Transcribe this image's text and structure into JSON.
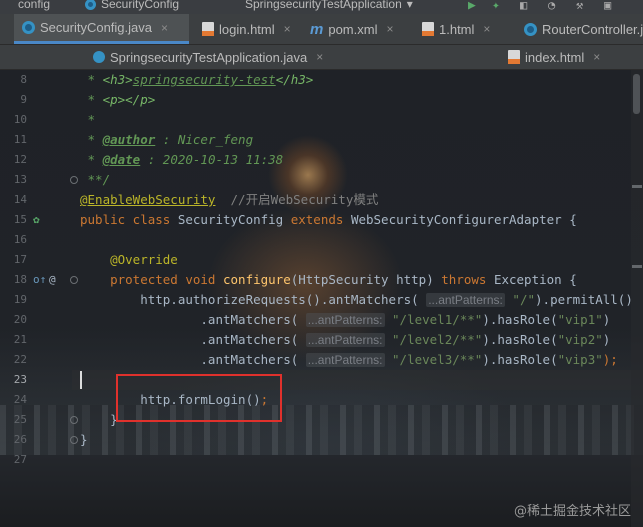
{
  "tabs_row1": {
    "items": [
      "config",
      "SecurityConfig",
      "SpringsecurityTestApplication"
    ]
  },
  "tabs_row2": [
    {
      "label": "SecurityConfig.java",
      "icon": "class-icon",
      "active": true
    },
    {
      "label": "login.html",
      "icon": "html-file-icon",
      "active": false
    },
    {
      "label": "pom.xml",
      "icon": "maven-icon",
      "active": false
    },
    {
      "label": "1.html",
      "icon": "html-file-icon",
      "active": false
    },
    {
      "label": "RouterController.jav",
      "icon": "class-icon",
      "active": false
    }
  ],
  "tabs_row3": [
    {
      "label": "SpringsecurityTestApplication.java",
      "icon": "spring-class-icon"
    },
    {
      "label": "index.html",
      "icon": "html-file-icon"
    }
  ],
  "close_glyph": "×",
  "line_numbers": [
    "8",
    "9",
    "10",
    "11",
    "12",
    "13",
    "14",
    "15",
    "16",
    "17",
    "18",
    "19",
    "20",
    "21",
    "22",
    "23",
    "24",
    "25",
    "26",
    "27"
  ],
  "code": {
    "l8_prefix": " * ",
    "l8_tag1": "<h3>",
    "l8_text": "springsecurity-test",
    "l8_tag2": "</h3>",
    "l9_prefix": " * ",
    "l9_tag": "<p></p>",
    "l10": " *",
    "l11_prefix": " * ",
    "l11_tag": "@author",
    "l11_text": " : Nicer_feng",
    "l12_prefix": " * ",
    "l12_tag": "@date",
    "l12_text": " : 2020-10-13 11:38",
    "l13": " **/",
    "l14_annotation": "@EnableWebSecurity",
    "l14_comment": "  //开启WebSecurity模式",
    "l15_kw1": "public class ",
    "l15_cls": "SecurityConfig ",
    "l15_kw2": "extends ",
    "l15_super": "WebSecurityConfigurerAdapter {",
    "l17_annotation": "    @Override",
    "l18_kw1": "    protected void ",
    "l18_fn": "configure",
    "l18_params": "(HttpSecurity http) ",
    "l18_kw2": "throws ",
    "l18_ex": "Exception {",
    "l19_a": "        http.authorizeRequests().antMatchers( ",
    "l19_hint": "...antPatterns:",
    "l19_str": " \"/\"",
    "l19_b": ").permitAll()",
    "l20_a": "                .antMatchers( ",
    "l20_hint": "...antPatterns:",
    "l20_str": " \"/level1/**\"",
    "l20_b": ").hasRole(",
    "l20_role": "\"vip1\"",
    "l20_c": ")",
    "l21_a": "                .antMatchers( ",
    "l21_hint": "...antPatterns:",
    "l21_str": " \"/level2/**\"",
    "l21_b": ").hasRole(",
    "l21_role": "\"vip2\"",
    "l21_c": ")",
    "l22_a": "                .antMatchers( ",
    "l22_hint": "...antPatterns:",
    "l22_str": " \"/level3/**\"",
    "l22_b": ").hasRole(",
    "l22_role": "\"vip3\"",
    "l22_c": ");",
    "l24_a": "        http.formLogin()",
    "l24_b": ";",
    "l25": "    }",
    "l26": "}"
  },
  "gutter_marks": {
    "override": "@",
    "impl": "o↑"
  },
  "watermark": "@稀土掘金技术社区",
  "colors": {
    "keyword": "#cc7832",
    "string": "#6a8759",
    "annotation": "#bbb529",
    "highlight_box": "#e0312c",
    "active_tab_underline": "#4a88c7"
  }
}
